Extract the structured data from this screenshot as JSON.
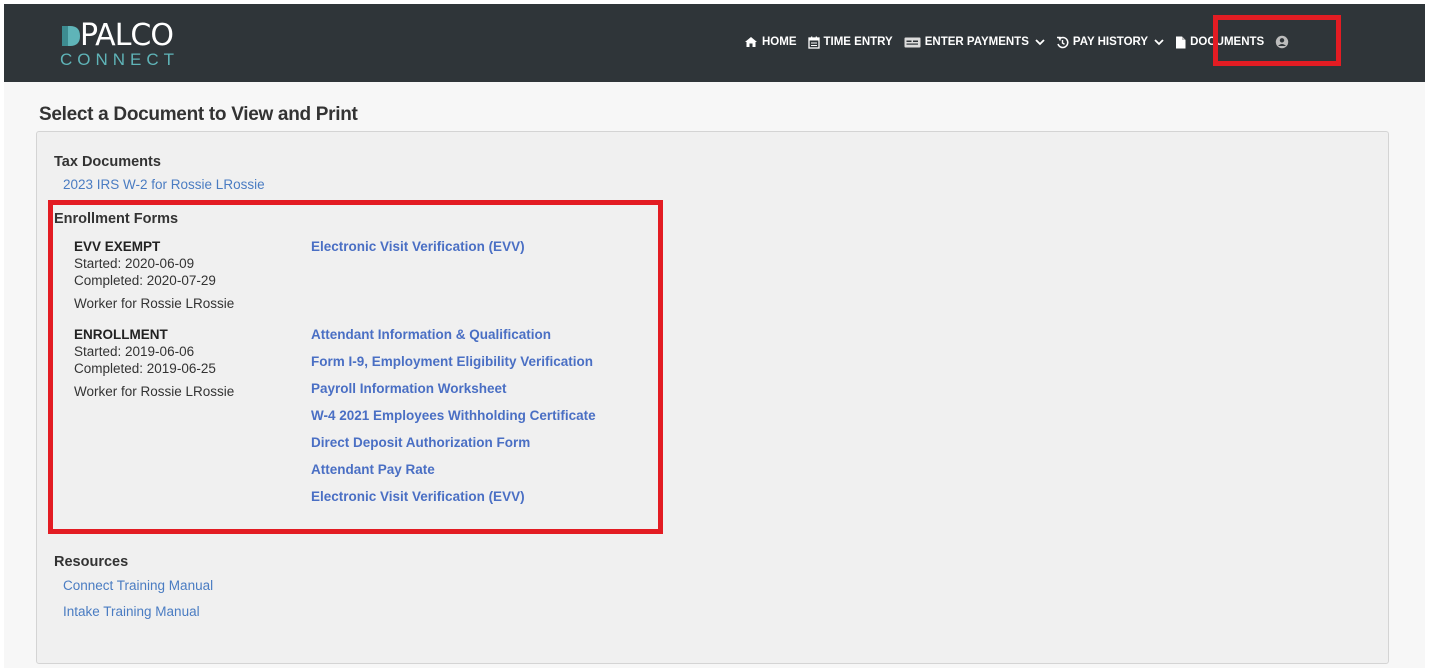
{
  "logo": {
    "line1": "PALCO",
    "line2": "CONNECT"
  },
  "nav": {
    "home": "HOME",
    "time_entry": "TIME ENTRY",
    "enter_payments": "ENTER PAYMENTS",
    "pay_history": "PAY HISTORY",
    "documents": "DOCUMENTS"
  },
  "page": {
    "title": "Select a Document to View and Print"
  },
  "tax": {
    "title": "Tax Documents",
    "links": [
      "2023 IRS W-2 for Rossie LRossie"
    ]
  },
  "enrollment": {
    "title": "Enrollment Forms",
    "groups": [
      {
        "name": "EVV EXEMPT",
        "started": "Started: 2020-06-09",
        "completed": "Completed: 2020-07-29",
        "worker": "Worker for Rossie LRossie",
        "forms": [
          "Electronic Visit Verification (EVV)"
        ]
      },
      {
        "name": "ENROLLMENT",
        "started": "Started: 2019-06-06",
        "completed": "Completed: 2019-06-25",
        "worker": "Worker for Rossie LRossie",
        "forms": [
          "Attendant Information & Qualification",
          "Form I-9, Employment Eligibility Verification",
          "Payroll Information Worksheet",
          "W-4 2021 Employees Withholding Certificate",
          "Direct Deposit Authorization Form",
          "Attendant Pay Rate",
          "Electronic Visit Verification (EVV)"
        ]
      }
    ]
  },
  "resources": {
    "title": "Resources",
    "links": [
      "Connect Training Manual",
      "Intake Training Manual"
    ]
  },
  "colors": {
    "topbar": "#2f3539",
    "accent_link": "#4a6fc4",
    "highlight": "#e31c23",
    "logo_teal": "#5fb4b8"
  }
}
